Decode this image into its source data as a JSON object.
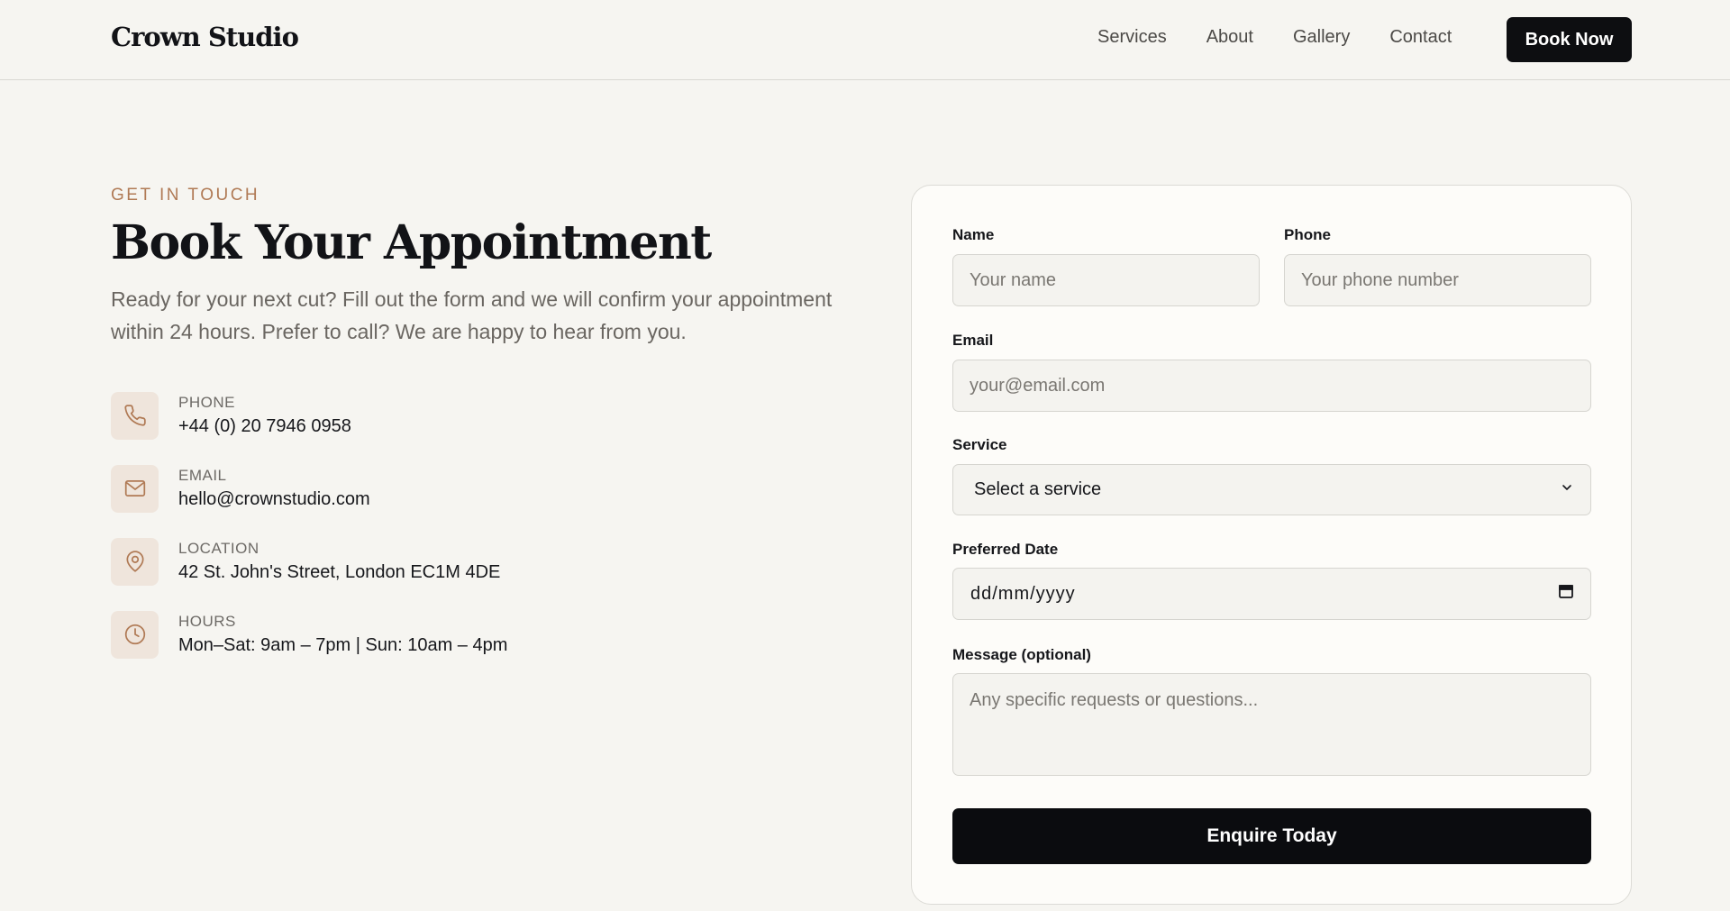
{
  "header": {
    "logo": "Crown Studio",
    "nav": [
      {
        "label": "Services"
      },
      {
        "label": "About"
      },
      {
        "label": "Gallery"
      },
      {
        "label": "Contact"
      }
    ],
    "cta_label": "Book Now"
  },
  "hero": {
    "eyebrow": "GET IN TOUCH",
    "title": "Book Your Appointment",
    "description": "Ready for your next cut? Fill out the form and we will confirm your appointment within 24 hours. Prefer to call? We are happy to hear from you."
  },
  "contacts": [
    {
      "icon": "phone-icon",
      "label": "PHONE",
      "value": "+44 (0) 20 7946 0958"
    },
    {
      "icon": "mail-icon",
      "label": "EMAIL",
      "value": "hello@crownstudio.com"
    },
    {
      "icon": "location-pin-icon",
      "label": "LOCATION",
      "value": "42 St. John's Street, London EC1M 4DE"
    },
    {
      "icon": "clock-icon",
      "label": "HOURS",
      "value": "Mon–Sat: 9am – 7pm | Sun: 10am – 4pm"
    }
  ],
  "form": {
    "name": {
      "label": "Name",
      "placeholder": "Your name",
      "value": ""
    },
    "phone": {
      "label": "Phone",
      "placeholder": "Your phone number",
      "value": ""
    },
    "email": {
      "label": "Email",
      "placeholder": "your@email.com",
      "value": ""
    },
    "service": {
      "label": "Service",
      "selected": "Select a service"
    },
    "date": {
      "label": "Preferred Date",
      "value": "dd/mm/yyyy"
    },
    "message": {
      "label": "Message (optional)",
      "placeholder": "Any specific requests or questions...",
      "value": ""
    },
    "submit_label": "Enquire Today"
  },
  "colors": {
    "background": "#f6f5f1",
    "accent": "#b07a55",
    "icon_bg": "#efe5dc",
    "primary_button": "#0d0e11",
    "card_bg": "#fdfcf9"
  }
}
